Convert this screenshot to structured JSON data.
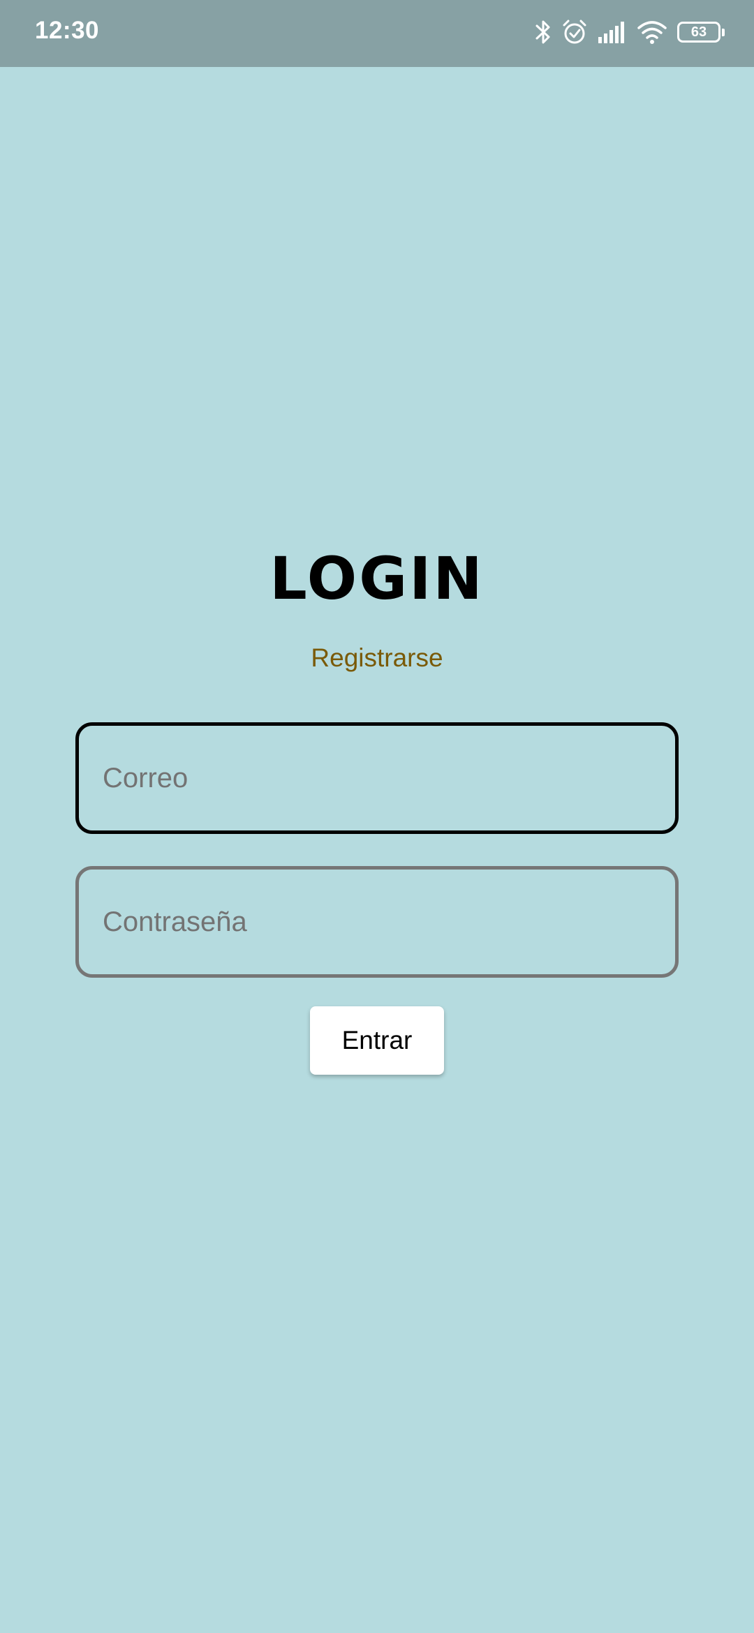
{
  "status_bar": {
    "time": "12:30",
    "icons": [
      "bluetooth-icon",
      "alarm-icon",
      "signal-icon",
      "wifi-icon",
      "battery-icon"
    ],
    "battery_level": "63"
  },
  "login": {
    "title": "LOGIN",
    "register_link": "Registrarse",
    "email_placeholder": "Correo",
    "password_placeholder": "Contraseña",
    "enter_button": "Entrar"
  },
  "colors": {
    "background": "#b5dbdf",
    "status_bar": "#87a1a4",
    "register_link": "#7a5a08",
    "focused_border": "#000000",
    "unfocused_border": "#767676"
  }
}
